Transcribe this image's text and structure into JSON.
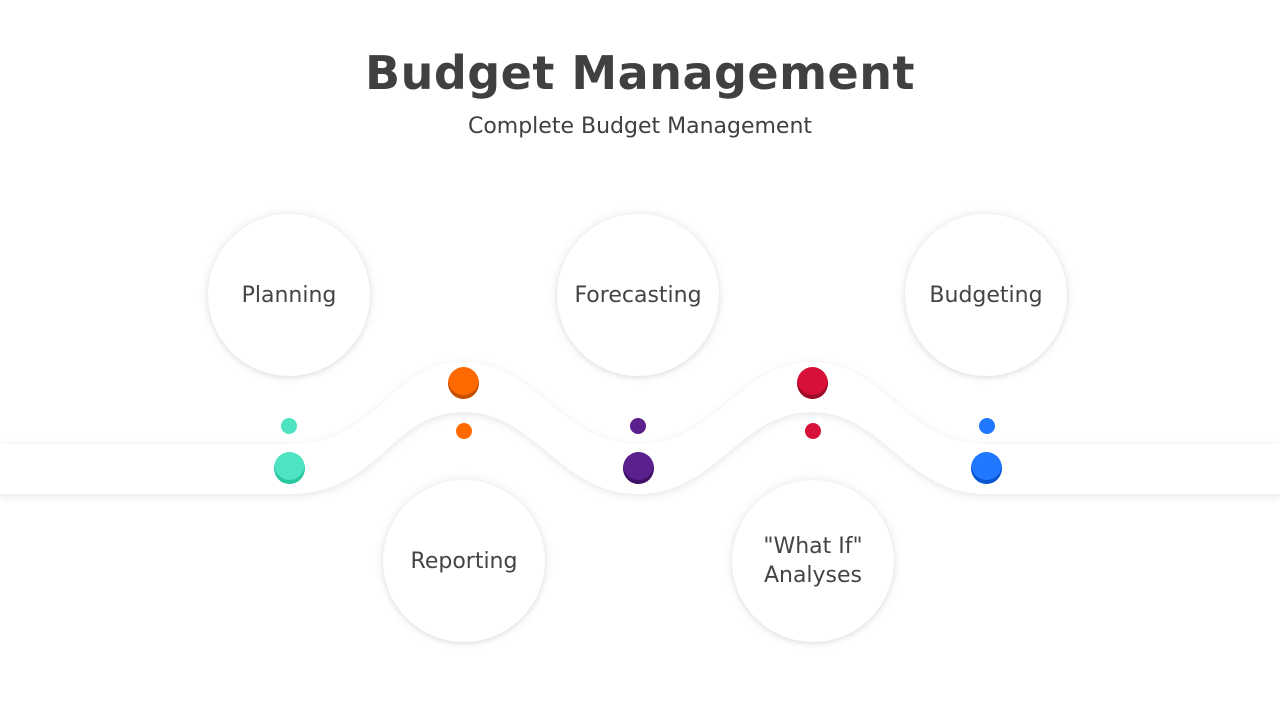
{
  "title": "Budget Management",
  "subtitle": "Complete Budget Management",
  "steps": [
    {
      "label": "Planning",
      "color": "#4ee3c1",
      "shade": "#27c7a0",
      "position": "top"
    },
    {
      "label": "Reporting",
      "color": "#ff6a00",
      "shade": "#c65000",
      "position": "bottom"
    },
    {
      "label": "Forecasting",
      "color": "#5b1f8e",
      "shade": "#3f1265",
      "position": "top"
    },
    {
      "label": "\"What If\" Analyses",
      "color": "#d61038",
      "shade": "#9c0b28",
      "position": "bottom"
    },
    {
      "label": "Budgeting",
      "color": "#1f78ff",
      "shade": "#0a55d0",
      "position": "top"
    }
  ]
}
